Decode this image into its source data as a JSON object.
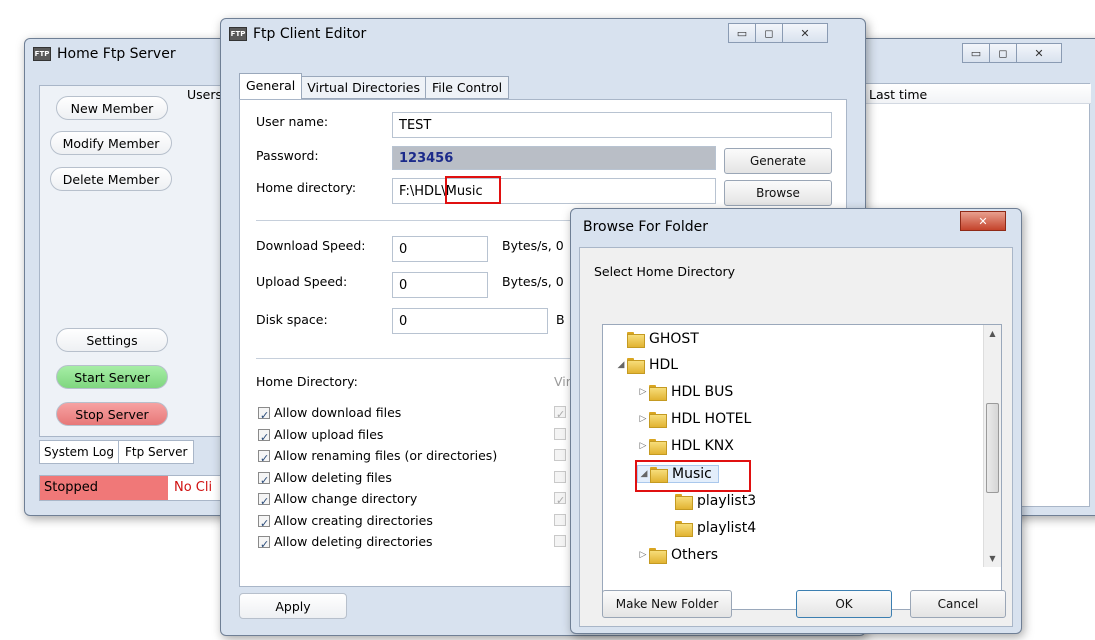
{
  "server_window": {
    "title": "Home Ftp Server",
    "icon": "FTP",
    "users_header": "Users",
    "last_time_header": "Last time",
    "buttons": {
      "new_member": "New Member",
      "modify_member": "Modify Member",
      "delete_member": "Delete Member",
      "settings": "Settings",
      "start_server": "Start Server",
      "stop_server": "Stop Server"
    },
    "tabs": [
      "System Log",
      "Ftp Server"
    ],
    "status": "Stopped",
    "clients_status": "No Cli"
  },
  "editor": {
    "title": "Ftp Client Editor",
    "icon": "FTP",
    "tabs": [
      "General",
      "Virtual Directories",
      "File Control"
    ],
    "user_name_label": "User name:",
    "user_name_value": "TEST",
    "password_label": "Password:",
    "password_value": "123456",
    "home_dir_label": "Home directory:",
    "home_dir_value_prefix": "F:\\HDL",
    "home_dir_value_suffix": "\\Music",
    "generate_button": "Generate",
    "browse_button": "Browse",
    "download_speed_label": "Download Speed:",
    "download_speed_value": "0",
    "download_unit": "Bytes/s, 0",
    "upload_speed_label": "Upload Speed:",
    "upload_speed_value": "0",
    "upload_unit": "Bytes/s, 0",
    "disk_space_label": "Disk space:",
    "disk_space_value": "0",
    "disk_unit": "B",
    "home_directory_section": "Home Directory:",
    "virtual_section": "Vir",
    "permissions": [
      {
        "label": "Allow download files",
        "checked": true
      },
      {
        "label": "Allow upload files",
        "checked": true
      },
      {
        "label": "Allow renaming files (or directories)",
        "checked": true
      },
      {
        "label": "Allow deleting files",
        "checked": true
      },
      {
        "label": "Allow change directory",
        "checked": true
      },
      {
        "label": "Allow creating directories",
        "checked": true
      },
      {
        "label": "Allow deleting directories",
        "checked": true
      }
    ],
    "apply_button": "Apply"
  },
  "browse_dialog": {
    "title": "Browse For Folder",
    "prompt": "Select Home Directory",
    "tree": [
      {
        "label": "GHOST",
        "arrow": ""
      },
      {
        "label": "HDL",
        "arrow": "◢"
      },
      {
        "label": "HDL BUS",
        "arrow": "▷"
      },
      {
        "label": "HDL HOTEL",
        "arrow": "▷"
      },
      {
        "label": "HDL KNX",
        "arrow": "▷"
      },
      {
        "label": "Music",
        "arrow": "◢"
      },
      {
        "label": "playlist3",
        "arrow": ""
      },
      {
        "label": "playlist4",
        "arrow": ""
      },
      {
        "label": "Others",
        "arrow": "▷"
      }
    ],
    "make_new_folder_button": "Make New Folder",
    "ok_button": "OK",
    "cancel_button": "Cancel"
  },
  "colors": {
    "start_green": "#8fe28f",
    "stop_red": "#f08888",
    "status_red": "#f07878",
    "highlight_red": "#e01010"
  }
}
